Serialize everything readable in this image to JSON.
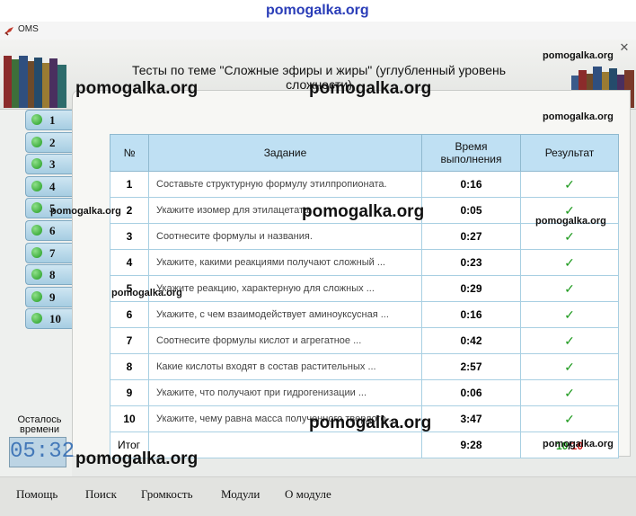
{
  "window": {
    "title": "OMS"
  },
  "header": {
    "title": "Тесты по теме \"Сложные эфиры и жиры\" (углубленный уровень сложности)"
  },
  "questions": [
    "1",
    "2",
    "3",
    "4",
    "5",
    "6",
    "7",
    "8",
    "9",
    "10"
  ],
  "table": {
    "headers": {
      "num": "№",
      "task": "Задание",
      "time": "Время выполнения",
      "result": "Результат"
    },
    "rows": [
      {
        "num": "1",
        "task": "Составьте структурную формулу этилпропионата.",
        "time": "0:16",
        "result": "✓"
      },
      {
        "num": "2",
        "task": "Укажите изомер для этилацетата",
        "time": "0:05",
        "result": "✓"
      },
      {
        "num": "3",
        "task": "Соотнесите формулы и названия.",
        "time": "0:27",
        "result": "✓"
      },
      {
        "num": "4",
        "task": "Укажите, какими реакциями получают сложный ...",
        "time": "0:23",
        "result": "✓"
      },
      {
        "num": "5",
        "task": "Укажите реакцию, характерную для сложных ...",
        "time": "0:29",
        "result": "✓"
      },
      {
        "num": "6",
        "task": "Укажите, с чем взаимодействует аминоуксусная ...",
        "time": "0:16",
        "result": "✓"
      },
      {
        "num": "7",
        "task": "Соотнесите формулы кислот и агрегатное ...",
        "time": "0:42",
        "result": "✓"
      },
      {
        "num": "8",
        "task": "Какие кислоты входят в состав растительных ...",
        "time": "2:57",
        "result": "✓"
      },
      {
        "num": "9",
        "task": "Укажите, что получают при гидрогенизации ...",
        "time": "0:06",
        "result": "✓"
      },
      {
        "num": "10",
        "task": "Укажите, чему равна масса полученного твердого ...",
        "time": "3:47",
        "result": "✓"
      }
    ],
    "total": {
      "label": "Итог",
      "time": "9:28",
      "score_correct": "10",
      "score_sep": "/",
      "score_total": "10"
    }
  },
  "timer": {
    "label": "Осталось времени",
    "value": "05:32"
  },
  "bottom_nav": [
    "Помощь",
    "Поиск",
    "Громкость",
    "Модули",
    "О модуле"
  ],
  "watermark": "pomogalka.org",
  "colors": {
    "check": "#1e9a1e",
    "score_total": "#d31616",
    "header_bg": "#bfe0f3"
  }
}
